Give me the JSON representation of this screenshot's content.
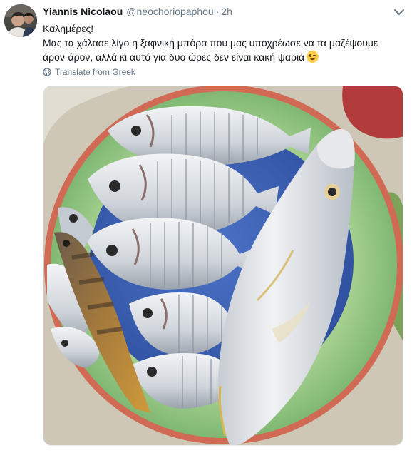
{
  "tweet": {
    "author_name": "Yiannis Nicolaou",
    "author_handle": "@neochoriopaphou",
    "separator": "·",
    "time": "2h",
    "text_line1": "Καλημέρες!",
    "text_line2": "Μας τα χάλασε λίγο η ξαφνική μπόρα που μας υποχρέωσε να τα μαζέψουμε",
    "text_line3": "άρον-άρον, αλλά κι αυτό για δυο ώρες δεν είναι κακή ψαριά",
    "emoji": "winking-face",
    "translate_label": "Translate from Greek"
  },
  "media": {
    "description_icon": "photo-of-fish-on-plate",
    "colors": {
      "plate_rim": "#d46a5a",
      "plate_green": "#8fc48a",
      "plate_center": "#3f62b8",
      "fish_silver": "#d9dde2",
      "tablecloth": "#cfc7b6"
    }
  },
  "icons": {
    "caret": "chevron-down-icon",
    "translate": "globe-icon"
  }
}
